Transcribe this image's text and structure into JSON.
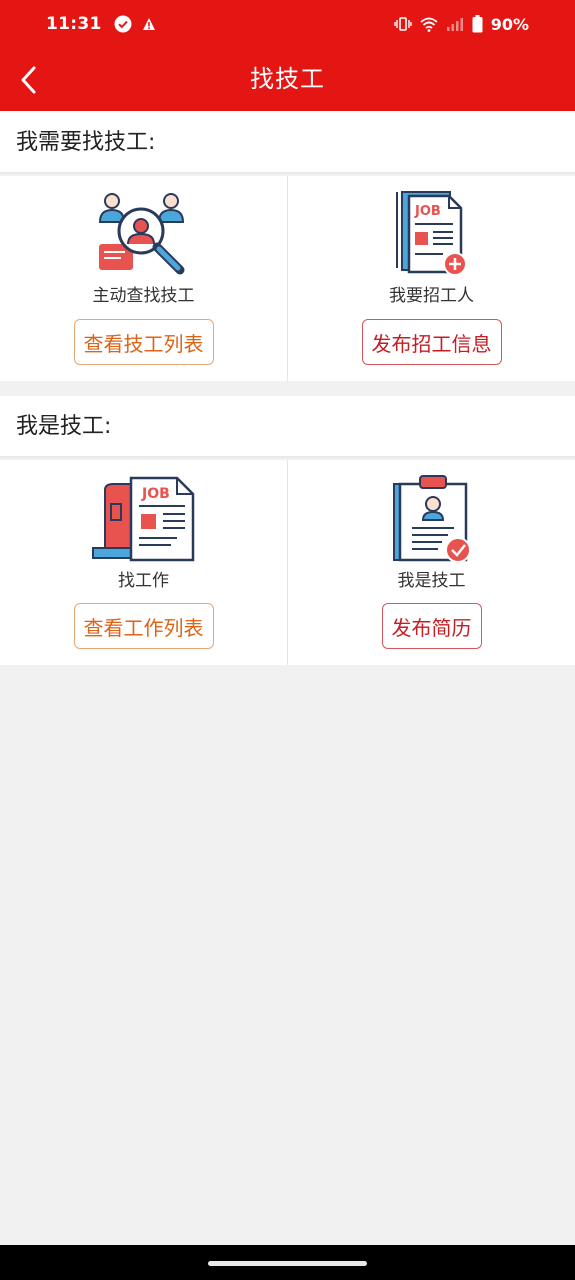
{
  "status_bar": {
    "time": "11:31",
    "battery": "90%"
  },
  "app_bar": {
    "title": "找技工"
  },
  "section_employer": {
    "title": "我需要找技工:",
    "cards": [
      {
        "label": "主动查找技工",
        "button": "查看技工列表",
        "icon": "search-worker-icon"
      },
      {
        "label": "我要招工人",
        "button": "发布招工信息",
        "icon": "job-post-add-icon"
      }
    ]
  },
  "section_worker": {
    "title": "我是技工:",
    "cards": [
      {
        "label": "找工作",
        "button": "查看工作列表",
        "icon": "job-listing-icon"
      },
      {
        "label": "我是技工",
        "button": "发布简历",
        "icon": "resume-check-icon"
      }
    ]
  },
  "colors": {
    "primary": "#e41613",
    "orange_button": "#de6316",
    "red_button": "#c61d23",
    "background": "#f1f1f1"
  }
}
